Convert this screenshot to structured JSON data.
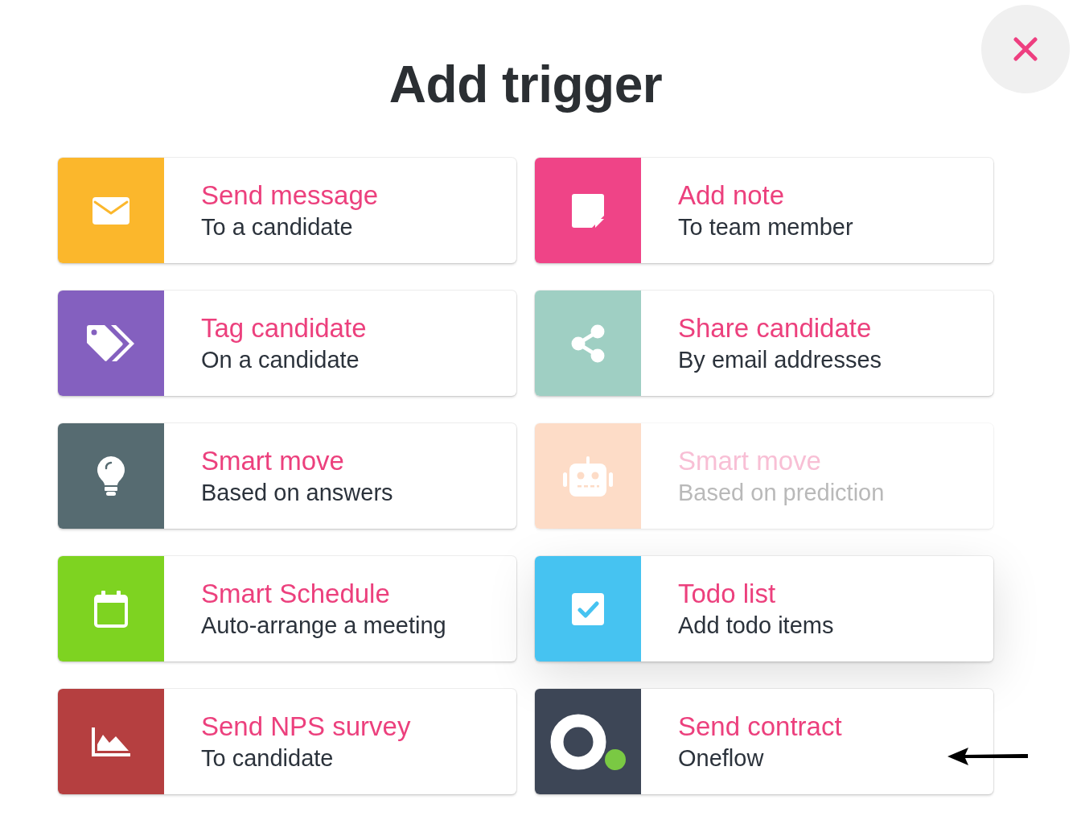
{
  "dialog": {
    "title": "Add trigger"
  },
  "items": [
    {
      "kind": "message",
      "title": "Send message",
      "subtitle": "To a candidate",
      "color": "#fbb72c",
      "disabled": false,
      "hovered": false
    },
    {
      "kind": "note",
      "title": "Add note",
      "subtitle": "To team member",
      "color": "#ef4487",
      "disabled": false,
      "hovered": false
    },
    {
      "kind": "tag",
      "title": "Tag candidate",
      "subtitle": "On a candidate",
      "color": "#8460bf",
      "disabled": false,
      "hovered": false
    },
    {
      "kind": "share",
      "title": "Share candidate",
      "subtitle": "By email addresses",
      "color": "#9fcfc3",
      "disabled": false,
      "hovered": false
    },
    {
      "kind": "idea",
      "title": "Smart move",
      "subtitle": "Based on answers",
      "color": "#566b71",
      "disabled": false,
      "hovered": false
    },
    {
      "kind": "robot",
      "title": "Smart move",
      "subtitle": "Based on prediction",
      "color": "#fddcc7",
      "disabled": true,
      "hovered": false
    },
    {
      "kind": "schedule",
      "title": "Smart Schedule",
      "subtitle": "Auto-arrange a meeting",
      "color": "#7ed321",
      "disabled": false,
      "hovered": false
    },
    {
      "kind": "todo",
      "title": "Todo list",
      "subtitle": "Add todo items",
      "color": "#46c3f1",
      "disabled": false,
      "hovered": true
    },
    {
      "kind": "survey",
      "title": "Send NPS survey",
      "subtitle": "To candidate",
      "color": "#b53f40",
      "disabled": false,
      "hovered": false
    },
    {
      "kind": "contract",
      "title": "Send contract",
      "subtitle": "Oneflow",
      "color": "#3d4656",
      "disabled": false,
      "hovered": false
    }
  ]
}
